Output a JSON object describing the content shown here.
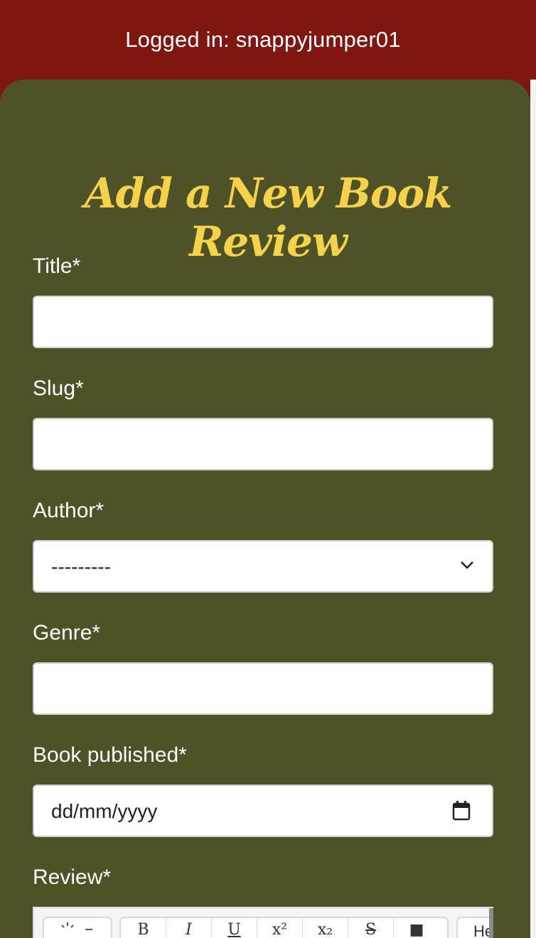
{
  "header": {
    "login_text": "Logged in: snappyjumper01"
  },
  "form": {
    "heading": "Add a New Book Review",
    "title": {
      "label": "Title*",
      "value": ""
    },
    "slug": {
      "label": "Slug*",
      "value": ""
    },
    "author": {
      "label": "Author*",
      "selected": "---------"
    },
    "genre": {
      "label": "Genre*",
      "value": ""
    },
    "published": {
      "label": "Book published*",
      "placeholder": "dd/mm/yyyy"
    },
    "review": {
      "label": "Review*"
    }
  },
  "editor_toolbar": {
    "buttons": [
      "B",
      "I",
      "U",
      "x²",
      "x₂",
      "S",
      "■"
    ],
    "heading_text": "He",
    "icons": [
      "theme-icon",
      "chevron-down-icon"
    ]
  },
  "colors": {
    "header_bg": "#7e1710",
    "panel_bg": "#4f5226",
    "heading": "#f5d24a"
  }
}
